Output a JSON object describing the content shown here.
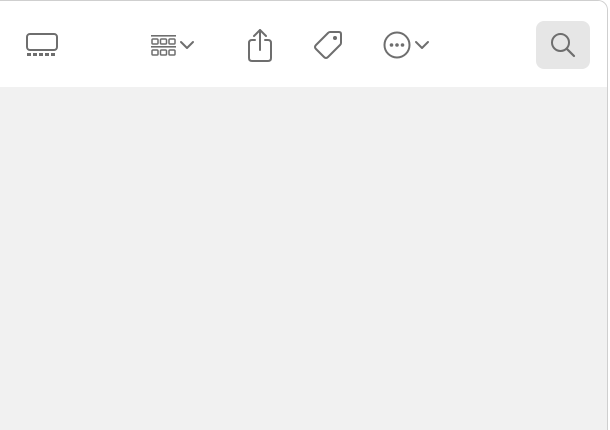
{
  "toolbar": {
    "items": [
      {
        "name": "gallery-view",
        "icon": "gallery-view-icon"
      },
      {
        "name": "view-options",
        "icon": "icon-grid-icon",
        "has_menu": true
      },
      {
        "name": "share",
        "icon": "share-icon"
      },
      {
        "name": "tags",
        "icon": "tag-icon"
      },
      {
        "name": "more-actions",
        "icon": "ellipsis-circle-icon",
        "has_menu": true
      },
      {
        "name": "search",
        "icon": "search-icon",
        "selected": true
      }
    ]
  },
  "colors": {
    "icon": "#6e6e6e",
    "content_background": "#f1f1f1",
    "toolbar_background": "#ffffff",
    "selected_button": "#e6e6e6"
  }
}
